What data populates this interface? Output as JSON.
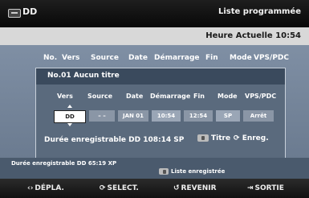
{
  "header": {
    "left_title": "DD",
    "right_title": "Liste programmée"
  },
  "clock": {
    "label": "Heure Actuelle 10:54"
  },
  "columns": [
    "No.",
    "Vers",
    "Source",
    "Date",
    "Démarrage",
    "Fin",
    "Mode",
    "VPS/PDC"
  ],
  "panel": {
    "title": "No.01 Aucun titre",
    "headers": [
      "Vers",
      "Source",
      "Date",
      "Démarrage",
      "Fin",
      "Mode",
      "VPS/PDC"
    ],
    "values": {
      "vers": "DD",
      "source": "– –",
      "date": "JAN 01",
      "start": "10:54",
      "end": "12:54",
      "mode": "SP",
      "vps": "Arrêt"
    },
    "duration": "Durée enregistrable  DD 108:14 SP",
    "title_button": "Titre",
    "enreg_button": "Enreg."
  },
  "lower": {
    "duration": "Durée enregistrable  DD 65:19 XP",
    "list_label": "Liste enregistrée"
  },
  "footer": {
    "move": "DÉPLA.",
    "select": "SELECT.",
    "back": "REVENIR",
    "exit": "SORTIE"
  },
  "icons": {
    "disc": "disc-icon",
    "remote_button": "remote-button-icon",
    "move": "arrows-icon",
    "select": "select-icon",
    "back": "return-icon",
    "exit": "exit-icon"
  }
}
